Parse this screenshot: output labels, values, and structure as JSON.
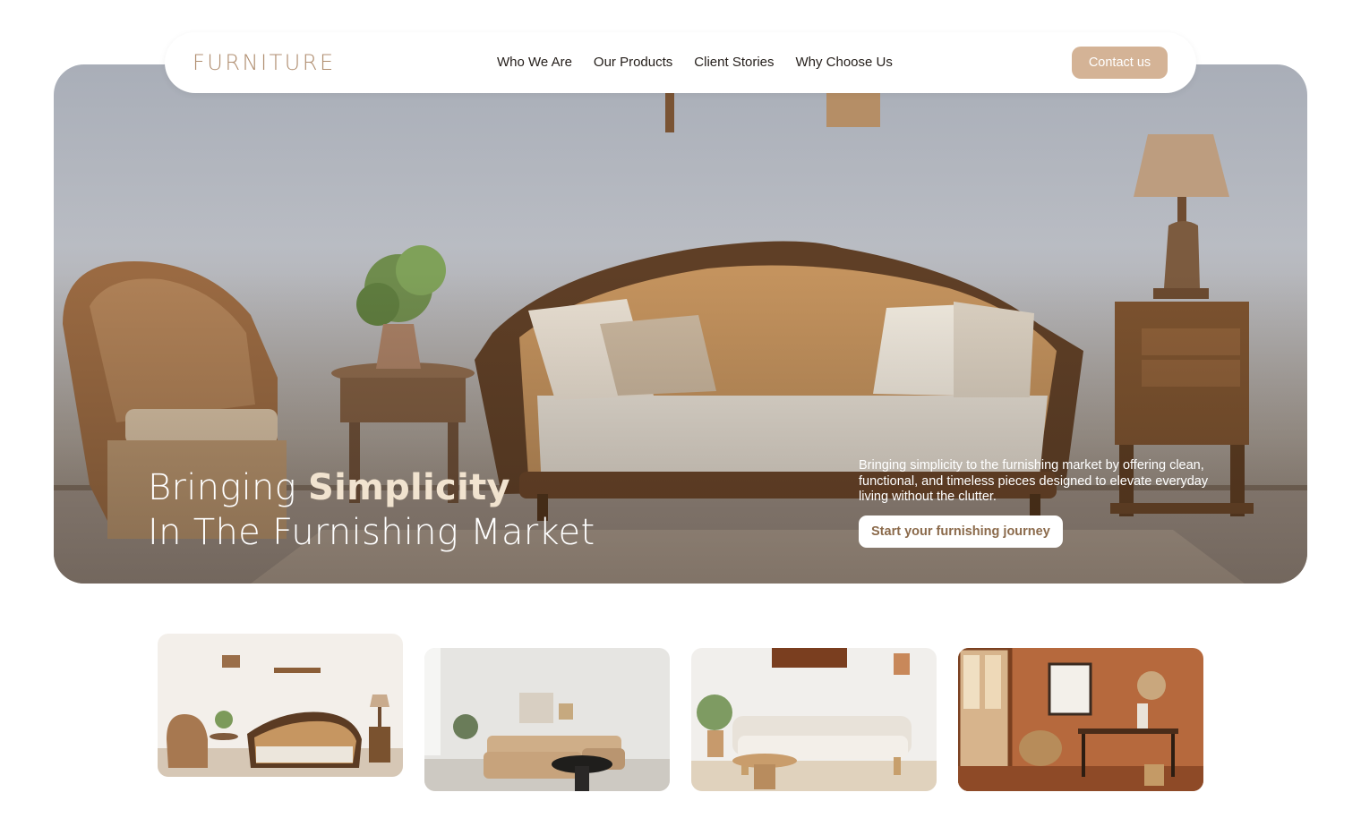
{
  "brand": {
    "logo_text": "FURNITURE",
    "accent_color": "#b08e70",
    "button_color": "#d4b396"
  },
  "nav": {
    "links": [
      "Who We Are",
      "Our Products",
      "Client Stories",
      "Why Choose Us"
    ],
    "contact_label": "Contact us"
  },
  "hero": {
    "headline_part1": "Bringing ",
    "headline_emphasis": "Simplicity",
    "headline_line2": "In The Furnishing Market",
    "description": "Bringing simplicity to the furnishing market by offering clean, functional, and timeless pieces designed to elevate everyday living without the clutter.",
    "cta_label": "Start your furnishing journey"
  },
  "gallery": {
    "items": [
      "rattan-chair-sofa-room",
      "beige-sectional-room",
      "cream-sofa-plants-room",
      "terracotta-workspace-room"
    ]
  }
}
